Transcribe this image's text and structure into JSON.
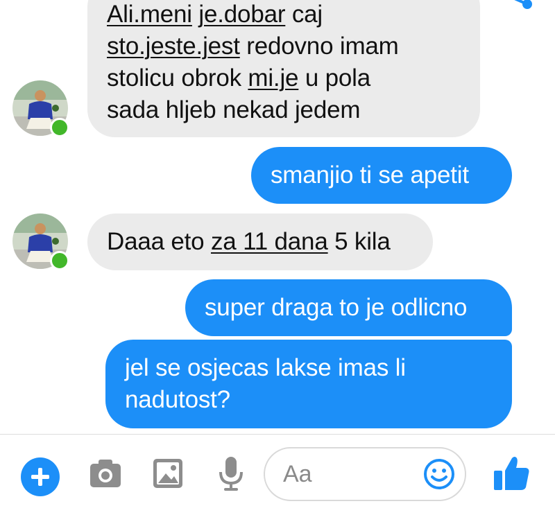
{
  "messages": [
    {
      "direction": "incoming",
      "lines": [
        [
          {
            "t": "Ali.meni",
            "u": true
          },
          {
            "t": " "
          },
          {
            "t": "je.dobar",
            "u": true
          },
          {
            "t": " caj"
          }
        ],
        [
          {
            "t": "sto.jeste.jest",
            "u": true
          },
          {
            "t": " redovno imam"
          }
        ],
        [
          {
            "t": "stolicu  obrok "
          },
          {
            "t": "mi.je",
            "u": true
          },
          {
            "t": " u pola"
          }
        ],
        [
          {
            "t": "sada hljeb nekad jedem"
          }
        ]
      ]
    },
    {
      "direction": "outgoing",
      "lines": [
        [
          {
            "t": "smanjio ti se apetit"
          }
        ]
      ]
    },
    {
      "direction": "incoming",
      "lines": [
        [
          {
            "t": "Daaa eto "
          },
          {
            "t": "za 11 dana",
            "u": true
          },
          {
            "t": " 5 kila"
          }
        ]
      ]
    },
    {
      "direction": "outgoing",
      "lines": [
        [
          {
            "t": "super draga to je odlicno"
          }
        ]
      ]
    },
    {
      "direction": "outgoing",
      "lines": [
        [
          {
            "t": "jel se osjecas lakse imas li"
          }
        ],
        [
          {
            "t": "nadutost?"
          }
        ]
      ]
    }
  ],
  "composer": {
    "placeholder": "Aa",
    "icons": [
      "plus-icon",
      "camera-icon",
      "image-icon",
      "microphone-icon",
      "emoji-icon",
      "thumbs-up-icon"
    ]
  },
  "colors": {
    "outgoing_bubble": "#1c8ff8",
    "incoming_bubble": "#ebebeb",
    "accent": "#1c8ff8",
    "online": "#42b72a"
  }
}
